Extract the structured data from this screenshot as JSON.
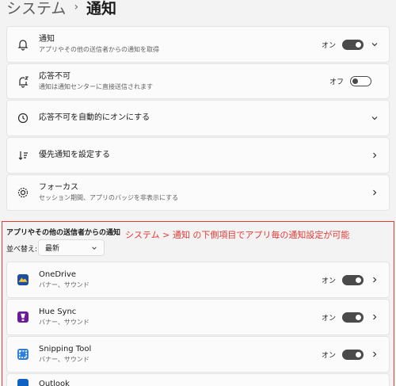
{
  "breadcrumb": {
    "parent": "システム",
    "separator": "›",
    "current": "通知"
  },
  "settings": [
    {
      "title": "通知",
      "desc": "アプリやその他の送信者からの通知を取得",
      "state": "オン",
      "toggle": "on",
      "chevron": "down"
    },
    {
      "title": "応答不可",
      "desc": "通知は通知センターに直接送信されます",
      "state": "オフ",
      "toggle": "off",
      "chevron": "none"
    },
    {
      "title": "応答不可を自動的にオンにする",
      "desc": "",
      "state": "",
      "toggle": "none",
      "chevron": "down"
    },
    {
      "title": "優先通知を設定する",
      "desc": "",
      "state": "",
      "toggle": "none",
      "chevron": "right"
    },
    {
      "title": "フォーカス",
      "desc": "セッション期間、アプリのバッジを非表示にする",
      "state": "",
      "toggle": "none",
      "chevron": "right"
    }
  ],
  "apps_section": {
    "title": "アプリやその他の送信者からの通知",
    "annotation": "システム > 通知 の下側項目でアプリ毎の通知設定が可能",
    "sort_label": "並べ替え:",
    "sort_value": "最新",
    "apps": [
      {
        "name": "OneDrive",
        "desc": "バナー、サウンド",
        "state": "オン",
        "icon_color": "#1f4e9c"
      },
      {
        "name": "Hue Sync",
        "desc": "バナー、サウンド",
        "state": "オン",
        "icon_color": "#6a1b9a"
      },
      {
        "name": "Snipping Tool",
        "desc": "バナー、サウンド",
        "state": "オン",
        "icon_color": "#2f7fd6"
      },
      {
        "name": "Outlook",
        "desc": "",
        "state": "",
        "icon_color": "#0f62c4"
      }
    ]
  },
  "colors": {
    "accent": "#4a4a4a",
    "annotation": "#e53935",
    "background": "#f3f3f3",
    "card": "#fbfbfb"
  }
}
